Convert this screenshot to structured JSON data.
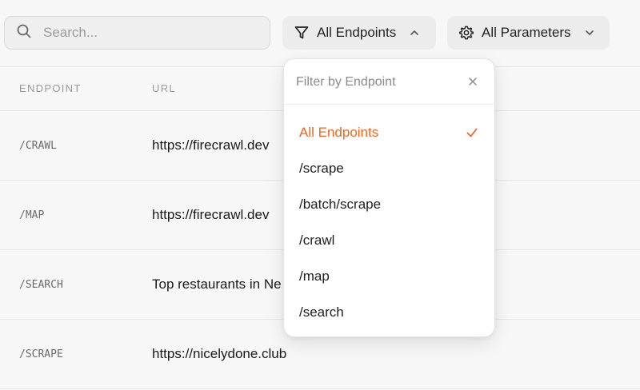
{
  "search": {
    "placeholder": "Search..."
  },
  "filters": {
    "endpoints_label": "All Endpoints",
    "parameters_label": "All Parameters"
  },
  "table": {
    "columns": [
      "ENDPOINT",
      "URL"
    ],
    "rows": [
      {
        "endpoint": "/CRAWL",
        "url": "https://firecrawl.dev"
      },
      {
        "endpoint": "/MAP",
        "url": "https://firecrawl.dev"
      },
      {
        "endpoint": "/SEARCH",
        "url": "Top restaurants in Ne"
      },
      {
        "endpoint": "/SCRAPE",
        "url": "https://nicelydone.club"
      }
    ]
  },
  "dropdown": {
    "title": "Filter by Endpoint",
    "options": [
      {
        "label": "All Endpoints",
        "selected": true
      },
      {
        "label": "/scrape",
        "selected": false
      },
      {
        "label": "/batch/scrape",
        "selected": false
      },
      {
        "label": "/crawl",
        "selected": false
      },
      {
        "label": "/map",
        "selected": false
      },
      {
        "label": "/search",
        "selected": false
      }
    ]
  },
  "colors": {
    "accent": "#f2651c",
    "background": "#f7f7f7",
    "divider": "#e6e6e6"
  },
  "icons": {
    "search": "search-icon",
    "filter": "filter-icon",
    "settings": "gear-icon",
    "chevron_up": "chevron-up-icon",
    "chevron_down": "chevron-down-icon",
    "close": "close-icon",
    "check": "check-icon"
  }
}
